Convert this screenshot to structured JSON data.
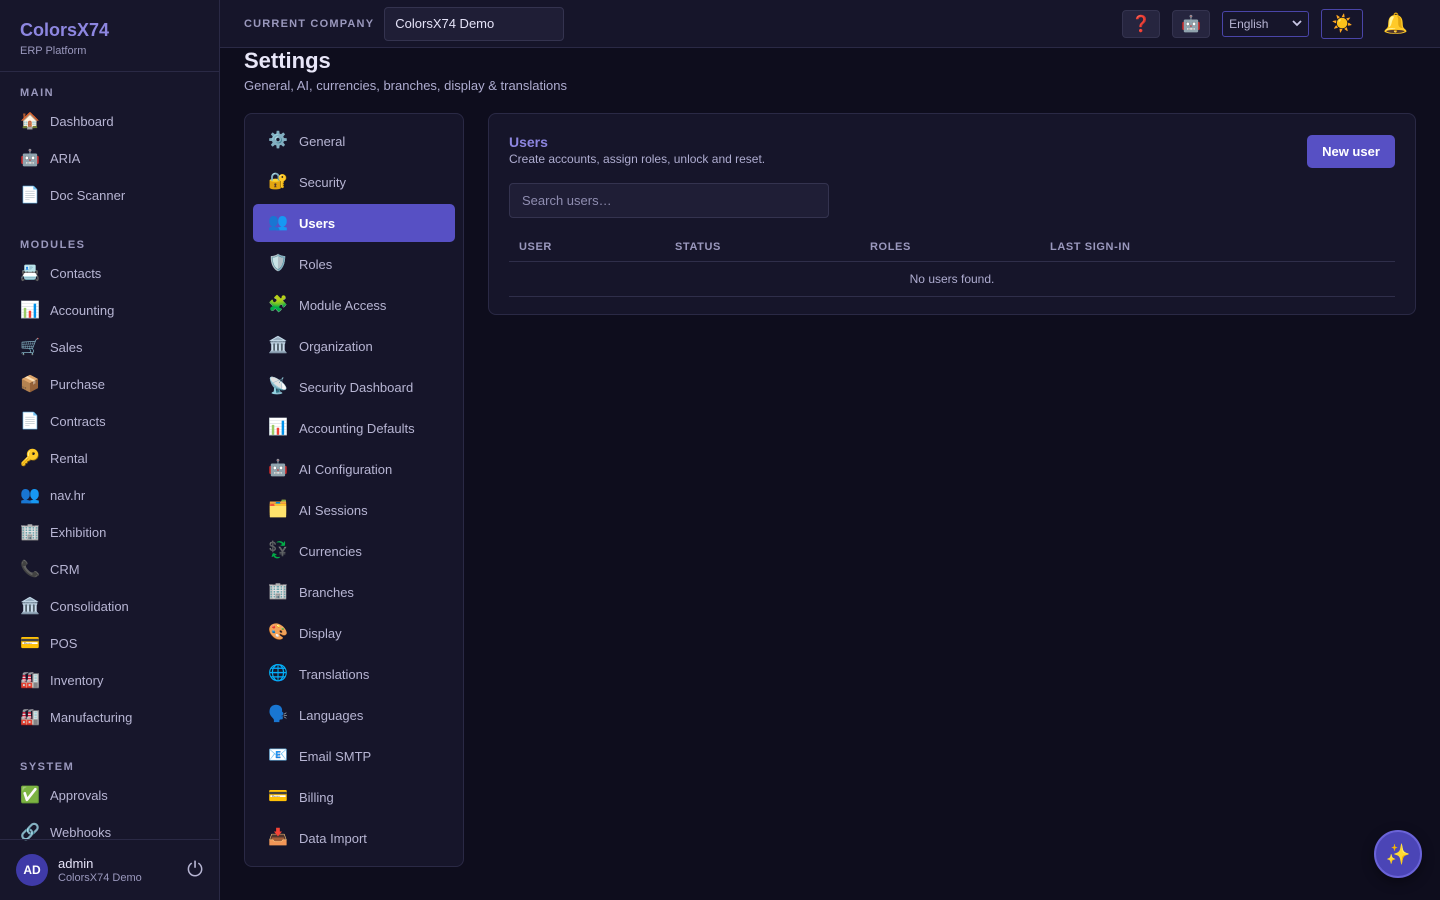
{
  "brand": {
    "name": "ColorsX74",
    "subtitle": "ERP Platform"
  },
  "sidebar": {
    "sections": [
      {
        "label": "MAIN",
        "items": [
          {
            "icon": "🏠",
            "icon_name": "home-icon",
            "label": "Dashboard"
          },
          {
            "icon": "🤖",
            "icon_name": "robot-icon",
            "label": "ARIA"
          },
          {
            "icon": "📄",
            "icon_name": "document-icon",
            "label": "Doc Scanner"
          }
        ]
      },
      {
        "label": "MODULES",
        "items": [
          {
            "icon": "📇",
            "icon_name": "card-index-icon",
            "label": "Contacts"
          },
          {
            "icon": "📊",
            "icon_name": "bar-chart-icon",
            "label": "Accounting"
          },
          {
            "icon": "🛒",
            "icon_name": "cart-icon",
            "label": "Sales"
          },
          {
            "icon": "📦",
            "icon_name": "package-icon",
            "label": "Purchase"
          },
          {
            "icon": "📄",
            "icon_name": "document-icon",
            "label": "Contracts"
          },
          {
            "icon": "🔑",
            "icon_name": "key-icon",
            "label": "Rental"
          },
          {
            "icon": "👥",
            "icon_name": "people-icon",
            "label": "nav.hr"
          },
          {
            "icon": "🏢",
            "icon_name": "office-building-icon",
            "label": "Exhibition"
          },
          {
            "icon": "📞",
            "icon_name": "phone-icon",
            "label": "CRM"
          },
          {
            "icon": "🏛️",
            "icon_name": "bank-icon",
            "label": "Consolidation"
          },
          {
            "icon": "💳",
            "icon_name": "credit-card-icon",
            "label": "POS"
          },
          {
            "icon": "🏭",
            "icon_name": "factory-icon",
            "label": "Inventory"
          },
          {
            "icon": "🏭",
            "icon_name": "factory-icon",
            "label": "Manufacturing"
          }
        ]
      },
      {
        "label": "SYSTEM",
        "items": [
          {
            "icon": "✅",
            "icon_name": "check-icon",
            "label": "Approvals"
          },
          {
            "icon": "🔗",
            "icon_name": "link-icon",
            "label": "Webhooks"
          }
        ]
      }
    ],
    "footer": {
      "avatar_initials": "AD",
      "user_name": "admin",
      "company": "ColorsX74 Demo",
      "logout_icon": "⏻"
    }
  },
  "topbar": {
    "company_label": "CURRENT COMPANY",
    "company_value": "ColorsX74 Demo",
    "help_icon": "❓",
    "assistant_icon": "🤖",
    "language": "English",
    "theme_icon": "☀️",
    "notifications_icon": "🔔"
  },
  "page": {
    "title": "Settings",
    "subtitle": "General, AI, currencies, branches, display & translations"
  },
  "settings_nav": [
    {
      "icon": "⚙️",
      "icon_name": "gear-icon",
      "label": "General",
      "active": false
    },
    {
      "icon": "🔐",
      "icon_name": "lock-key-icon",
      "label": "Security",
      "active": false
    },
    {
      "icon": "👥",
      "icon_name": "people-icon",
      "label": "Users",
      "active": true
    },
    {
      "icon": "🛡️",
      "icon_name": "shield-icon",
      "label": "Roles",
      "active": false
    },
    {
      "icon": "🧩",
      "icon_name": "puzzle-icon",
      "label": "Module Access",
      "active": false
    },
    {
      "icon": "🏛️",
      "icon_name": "bank-icon",
      "label": "Organization",
      "active": false
    },
    {
      "icon": "📡",
      "icon_name": "satellite-icon",
      "label": "Security Dashboard",
      "active": false
    },
    {
      "icon": "📊",
      "icon_name": "bar-chart-icon",
      "label": "Accounting Defaults",
      "active": false
    },
    {
      "icon": "🤖",
      "icon_name": "robot-icon",
      "label": "AI Configuration",
      "active": false
    },
    {
      "icon": "🗂️",
      "icon_name": "folder-dividers-icon",
      "label": "AI Sessions",
      "active": false
    },
    {
      "icon": "💱",
      "icon_name": "currency-exchange-icon",
      "label": "Currencies",
      "active": false
    },
    {
      "icon": "🏢",
      "icon_name": "office-building-icon",
      "label": "Branches",
      "active": false
    },
    {
      "icon": "🎨",
      "icon_name": "palette-icon",
      "label": "Display",
      "active": false
    },
    {
      "icon": "🌐",
      "icon_name": "globe-icon",
      "label": "Translations",
      "active": false
    },
    {
      "icon": "🗣️",
      "icon_name": "speaking-head-icon",
      "label": "Languages",
      "active": false
    },
    {
      "icon": "📧",
      "icon_name": "email-icon",
      "label": "Email SMTP",
      "active": false
    },
    {
      "icon": "💳",
      "icon_name": "credit-card-icon",
      "label": "Billing",
      "active": false
    },
    {
      "icon": "📥",
      "icon_name": "inbox-tray-icon",
      "label": "Data Import",
      "active": false
    }
  ],
  "users_panel": {
    "title": "Users",
    "subtitle": "Create accounts, assign roles, unlock and reset.",
    "new_user_label": "New user",
    "search_placeholder": "Search users…",
    "columns": [
      "USER",
      "STATUS",
      "ROLES",
      "LAST SIGN-IN"
    ],
    "empty_message": "No users found."
  },
  "fab_icon": "✨",
  "colors": {
    "accent": "#5750c4",
    "brand": "#8d86e0",
    "background": "#0e0d1d",
    "panel": "#16152a"
  }
}
